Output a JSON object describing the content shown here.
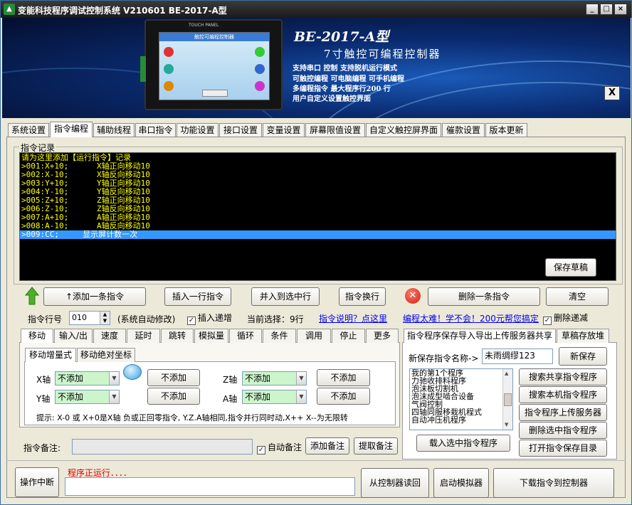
{
  "window": {
    "title": "变能科技程序调试控制系统 V210601  BE-2017-A型",
    "minimize": "_",
    "maximize": "□",
    "close": "×"
  },
  "banner": {
    "model": "BE-2017-A型",
    "subtitle": "7寸触控可编程控制器",
    "features": [
      "支持串口 控制 支持脱机运行模式",
      "可触控编程 可电脑编程 可手机编程",
      "多编程指令 最大程序行200 行",
      "用户自定义设置触控界面"
    ],
    "device_label": "TOUCH PANEL",
    "device_screen_title": "触控可编程控制器",
    "close_label": "X"
  },
  "main_tabs": [
    "系统设置",
    "指令编程",
    "辅助线程",
    "串口指令",
    "功能设置",
    "接口设置",
    "变量设置",
    "屏幕限值设置",
    "自定义触控屏界面",
    "催款设置",
    "版本更新"
  ],
  "records": {
    "group_label": "指令记录",
    "header": "请为这里添加【运行指令】记录",
    "lines": [
      ">001:X+10;      X轴正向移动10",
      ">002:X-10;      X轴反向移动10",
      ">003:Y+10;      Y轴正向移动10",
      ">004:Y-10;      Y轴反向移动10",
      ">005:Z+10;      Z轴正向移动10",
      ">006:Z-10;      Z轴反向移动10",
      ">007:A+10;      A轴正向移动10",
      ">008:A-10;      A轴反向移动10"
    ],
    "selected_line": ">009:CC;     显示屏计数一次",
    "save_draft": "保存草稿"
  },
  "toolbar": {
    "add": "添加一条指令",
    "insert": "插入一行指令",
    "merge": "并入到选中行",
    "wrap": "指令换行",
    "delete": "删除一条指令",
    "clear": "清空"
  },
  "lineinfo": {
    "row_label": "指令行号",
    "row_value": "010",
    "auto_note": "(系统自动修改)",
    "insert_inc": "插入递增",
    "insert_inc_checked": true,
    "current_select": "当前选择：9行",
    "help_link": "指令说明？点这里",
    "promo_link": "编程太难！学不会！200元帮您搞定",
    "delete_dec": "删除递减",
    "delete_dec_checked": true
  },
  "cmd_tabs": [
    "移动",
    "输入/出",
    "速度",
    "延时",
    "跳转",
    "模拟量",
    "循环",
    "条件",
    "调用",
    "停止",
    "更多"
  ],
  "move": {
    "subtabs": [
      "移动增量式",
      "移动绝对坐标"
    ],
    "axes": [
      {
        "label": "X轴",
        "value": "不添加",
        "button": "不添加"
      },
      {
        "label": "Z轴",
        "value": "不添加",
        "button": "不添加"
      },
      {
        "label": "Y轴",
        "value": "不添加",
        "button": "不添加"
      },
      {
        "label": "A轴",
        "value": "不添加",
        "button": "不添加"
      }
    ],
    "hint": "提示: X-0 或 X+0是X轴 负或正回零指令, Y.Z.A轴相同,指令并行同时动,X++ X--为无限转"
  },
  "note": {
    "label": "指令备注:",
    "value": "",
    "auto": "自动备注",
    "auto_checked": true,
    "add": "添加备注",
    "extract": "提取备注"
  },
  "right_panel": {
    "tabs": [
      "指令程序保存导入导出上传服务器共享",
      "草稿存放堆"
    ],
    "name_label": "新保存指令名称->",
    "name_value": "未雨绸缪123",
    "new_save": "新保存",
    "programs": [
      "我的第1个程序",
      "力驰收排料程序",
      "泡沫板切割机",
      "泡沫成型啮合设备",
      "气阀控制",
      "四轴同服移栽机程式",
      "自动冲压机程序"
    ],
    "buttons": [
      "搜索共享指令程序",
      "搜索本机指令程序",
      "指令程序上传服务器",
      "删除选中指令程序",
      "打开指令保存目录"
    ],
    "load": "载入选中指令程序"
  },
  "bottom": {
    "interrupt": "操作中断",
    "status": "程序正运行．．．．",
    "progress": 0,
    "read_back": "从控制器读回",
    "start_sim": "启动模拟器",
    "download": "下载指令到控制器"
  },
  "colors": {
    "console_bg": "#000000",
    "console_text": "#ffff00",
    "console_header": "#ffff00",
    "selection": "#3399ff",
    "status_red": "#e00000",
    "combo_bg": "#ccf5cc",
    "link": "#0000ee"
  }
}
